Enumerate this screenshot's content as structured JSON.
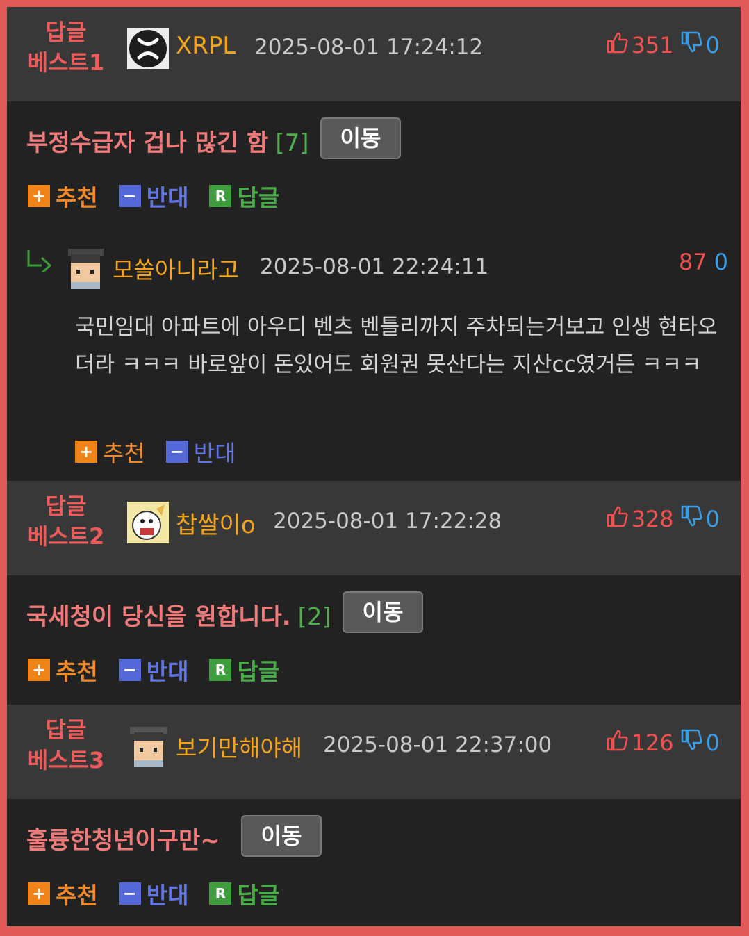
{
  "best": [
    {
      "rank_line1": "답글",
      "rank_line2": "베스트1",
      "username": "XRPL",
      "date": "2025-08-01 17:24:12",
      "up": "351",
      "down": "0",
      "title": "부정수급자 겁나 많긴 함",
      "reply_count": "[7]",
      "move_label": "이동",
      "recommend_label": "추천",
      "oppose_label": "반대",
      "reply_label": "답글"
    },
    {
      "rank_line1": "답글",
      "rank_line2": "베스트2",
      "username": "찹쌀이o",
      "date": "2025-08-01 17:22:28",
      "up": "328",
      "down": "0",
      "title": "국세청이 당신을 원합니다.",
      "reply_count": "[2]",
      "move_label": "이동",
      "recommend_label": "추천",
      "oppose_label": "반대",
      "reply_label": "답글"
    },
    {
      "rank_line1": "답글",
      "rank_line2": "베스트3",
      "username": "보기만해야해",
      "date": "2025-08-01 22:37:00",
      "up": "126",
      "down": "0",
      "title": "훌륭한청년이구만~",
      "move_label": "이동",
      "recommend_label": "추천",
      "oppose_label": "반대",
      "reply_label": "답글"
    }
  ],
  "reply": {
    "username": "모쏠아니라고",
    "date": "2025-08-01 22:24:11",
    "score_up": "87",
    "score_down": "0",
    "text": "국민임대 아파트에 아우디 벤츠 벤틀리까지 주차되는거보고 인생 현타오더라 ㅋㅋㅋ 바로앞이 돈있어도 회원권 못산다는 지산cc였거든 ㅋㅋㅋ",
    "recommend_label": "추천",
    "oppose_label": "반대"
  },
  "icons": {
    "thumb_up": "thumbs-up-icon",
    "thumb_down": "thumbs-down-icon",
    "reply_arrow": "reply-arrow-icon"
  },
  "colors": {
    "frame_border": "#e2595a",
    "header_bg": "#383838",
    "section_bg": "#222222",
    "rank_red": "#ef5a5a",
    "username_orange": "#f3a41c",
    "up_red": "#ef5050",
    "down_blue": "#3a9ee6"
  }
}
